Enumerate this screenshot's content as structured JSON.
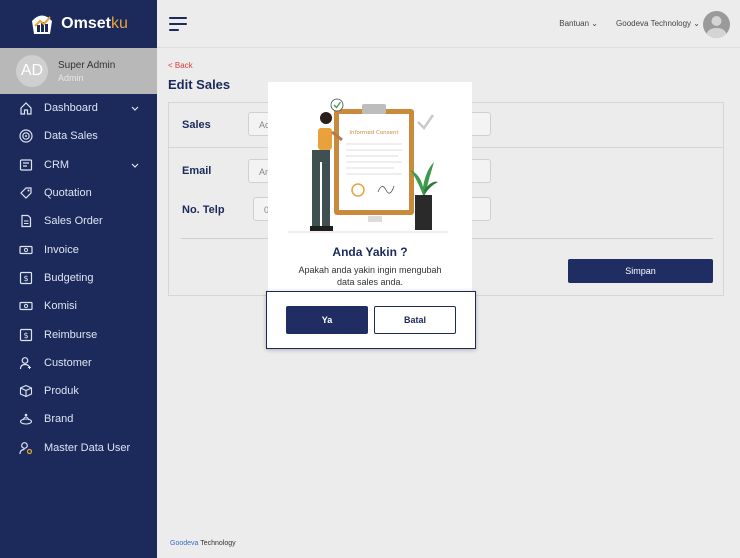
{
  "brand": {
    "name_main": "Omset",
    "name_accent": "ku"
  },
  "profile": {
    "initials": "AD",
    "name": "Super Admin",
    "role": "Admin"
  },
  "sidebar": {
    "items": [
      {
        "label": "Dashboard",
        "icon": "home-icon",
        "chevron": true
      },
      {
        "label": "Data Sales",
        "icon": "target-icon",
        "chevron": false
      },
      {
        "label": "CRM",
        "icon": "crm-icon",
        "chevron": true
      },
      {
        "label": "Quotation",
        "icon": "tag-icon",
        "chevron": false
      },
      {
        "label": "Sales Order",
        "icon": "document-icon",
        "chevron": false
      },
      {
        "label": "Invoice",
        "icon": "invoice-icon",
        "chevron": false
      },
      {
        "label": "Budgeting",
        "icon": "budget-icon",
        "chevron": false
      },
      {
        "label": "Komisi",
        "icon": "commission-icon",
        "chevron": false
      },
      {
        "label": "Reimburse",
        "icon": "reimburse-icon",
        "chevron": false
      },
      {
        "label": "Customer",
        "icon": "customer-icon",
        "chevron": false
      },
      {
        "label": "Produk",
        "icon": "box-icon",
        "chevron": false
      },
      {
        "label": "Brand",
        "icon": "brand-icon",
        "chevron": false
      },
      {
        "label": "Master Data User",
        "icon": "user-settings-icon",
        "chevron": false
      }
    ]
  },
  "topbar": {
    "help": "Bantuan",
    "company": "Goodeva Technology"
  },
  "page": {
    "back": "< Back",
    "title": "Edit Sales",
    "fields": {
      "sales_label": "Sales",
      "sales_value": "Ac",
      "email_label": "Email",
      "email_value": "Ar",
      "phone_label": "No. Telp",
      "phone_value": "08"
    },
    "save_label": "Simpan"
  },
  "modal": {
    "illustration_text": "Informed Consent",
    "title": "Anda Yakin ?",
    "message": "Apakah anda yakin ingin mengubah data sales anda.",
    "confirm_label": "Ya",
    "cancel_label": "Batal"
  },
  "footer": {
    "brand": "Goodeva",
    "rest": " Technology"
  },
  "colors": {
    "sidebar": "#1b2a5a",
    "primary": "#1f2d63",
    "accent": "#e9a23b",
    "back": "#d83b3b"
  }
}
